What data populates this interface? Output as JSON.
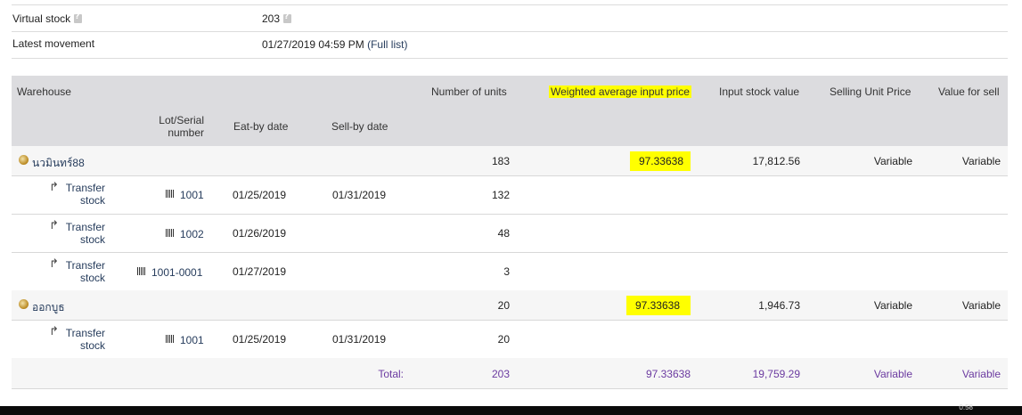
{
  "info": {
    "virtual_stock_label": "Virtual stock",
    "virtual_stock_value": "203",
    "latest_movement_label": "Latest movement",
    "latest_movement_value": "01/27/2019 04:59 PM",
    "full_list_link": "(Full list)"
  },
  "table": {
    "headers": {
      "warehouse": "Warehouse",
      "lot_serial_1": "Lot/Serial",
      "lot_serial_2": "number",
      "eat_by": "Eat-by date",
      "sell_by": "Sell-by date",
      "units": "Number of units",
      "wap": "Weighted average input price",
      "stock_value": "Input stock value",
      "selling_price": "Selling Unit Price",
      "value_for_sell": "Value for sell"
    },
    "warehouses": [
      {
        "name": "นวมินทร์88",
        "units": "183",
        "wap": "97.33638",
        "stock_value": "17,812.56",
        "selling_price": "Variable",
        "value_for_sell": "Variable",
        "lots": [
          {
            "action_1": "Transfer",
            "action_2": "stock",
            "lot": "1001",
            "eat_by": "01/25/2019",
            "sell_by": "01/31/2019",
            "units": "132"
          },
          {
            "action_1": "Transfer",
            "action_2": "stock",
            "lot": "1002",
            "eat_by": "01/26/2019",
            "sell_by": "",
            "units": "48"
          },
          {
            "action_1": "Transfer",
            "action_2": "stock",
            "lot": "1001-0001",
            "eat_by": "01/27/2019",
            "sell_by": "",
            "units": "3"
          }
        ]
      },
      {
        "name": "ออกบูธ",
        "units": "20",
        "wap": "97.33638",
        "stock_value": "1,946.73",
        "selling_price": "Variable",
        "value_for_sell": "Variable",
        "lots": [
          {
            "action_1": "Transfer",
            "action_2": "stock",
            "lot": "1001",
            "eat_by": "01/25/2019",
            "sell_by": "01/31/2019",
            "units": "20"
          }
        ]
      }
    ],
    "total": {
      "label": "Total:",
      "units": "203",
      "wap": "97.33638",
      "stock_value": "19,759.29",
      "selling_price": "Variable",
      "value_for_sell": "Variable"
    }
  },
  "taskbar": {
    "clock": "0:58"
  },
  "colors": {
    "highlight": "#ffff00",
    "header_bg": "#dcdcdf",
    "total_text": "#6b3aa0",
    "link": "#1e3a6e"
  }
}
